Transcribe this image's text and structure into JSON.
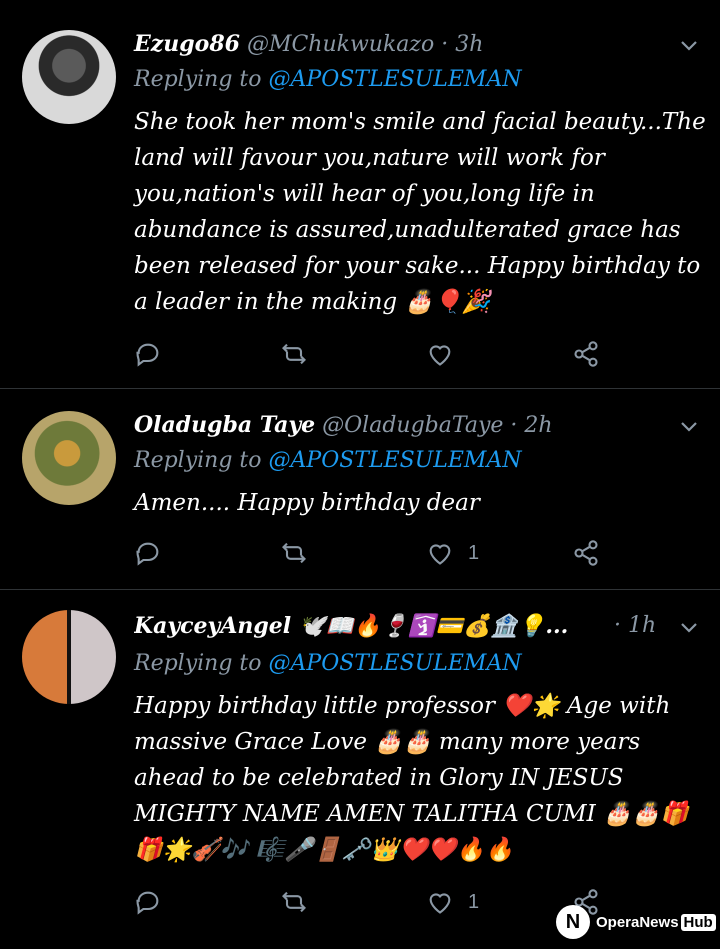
{
  "tweets": [
    {
      "name": "Ezugo86",
      "handle": "@MChukwukazo",
      "time": "· 3h",
      "replying_label": "Replying to",
      "mention": "@APOSTLESULEMAN",
      "text": "She took her mom's smile and facial beauty...The land will favour you,nature will work for you,nation's will hear of you,long life in abundance is assured,unadulterated grace has been released for your sake... Happy birthday to a leader in the making 🎂🎈🎉",
      "likes": ""
    },
    {
      "name": "Oladugba Taye",
      "handle": "@OladugbaTaye",
      "time": "· 2h",
      "replying_label": "Replying to",
      "mention": "@APOSTLESULEMAN",
      "text": "Amen.... Happy birthday dear",
      "likes": "1"
    },
    {
      "name": "KayceyAngel 🕊️📖🔥🍷🛐💳💰🏦💡...",
      "handle": "",
      "time": "· 1h",
      "replying_label": "Replying to",
      "mention": "@APOSTLESULEMAN",
      "text": "Happy birthday little professor ❤️🌟 Age with massive Grace Love 🎂🎂 many more years ahead to be celebrated in Glory IN JESUS MIGHTY NAME AMEN TALITHA CUMI 🎂🎂🎁🎁🌟🎻🎶 🎼🎤🚪🗝️👑❤️❤️🔥🔥",
      "likes": "1"
    }
  ],
  "watermark": {
    "mark": "N",
    "text": "OperaNews",
    "hub": "Hub"
  },
  "colors": {
    "background": "#000000",
    "muted": "#8b98a5",
    "mention": "#1d9bf0"
  },
  "icons": [
    "reply-icon",
    "retweet-icon",
    "like-icon",
    "share-icon",
    "chevron-down-icon"
  ]
}
